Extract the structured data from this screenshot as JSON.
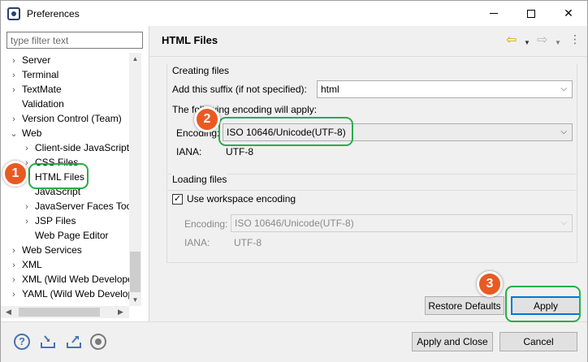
{
  "window": {
    "title": "Preferences"
  },
  "sidebar": {
    "filter_placeholder": "type filter text",
    "items": [
      {
        "label": "Server",
        "chevron": "›"
      },
      {
        "label": "Terminal",
        "chevron": "›"
      },
      {
        "label": "TextMate",
        "chevron": "›"
      },
      {
        "label": "Validation",
        "chevron": ""
      },
      {
        "label": "Version Control (Team)",
        "chevron": "›"
      },
      {
        "label": "Web",
        "chevron": "⌄"
      },
      {
        "label": "Client-side JavaScript",
        "chevron": "›"
      },
      {
        "label": "CSS Files",
        "chevron": "›"
      },
      {
        "label": "HTML Files",
        "chevron": ""
      },
      {
        "label": "JavaScript",
        "chevron": ""
      },
      {
        "label": "JavaServer Faces Tools",
        "chevron": "›"
      },
      {
        "label": "JSP Files",
        "chevron": "›"
      },
      {
        "label": "Web Page Editor",
        "chevron": ""
      },
      {
        "label": "Web Services",
        "chevron": "›"
      },
      {
        "label": "XML",
        "chevron": "›"
      },
      {
        "label": "XML (Wild Web Developer)",
        "chevron": "›"
      },
      {
        "label": "YAML (Wild Web Developer)",
        "chevron": "›"
      }
    ]
  },
  "page": {
    "title": "HTML Files",
    "creating": {
      "group_title": "Creating files",
      "suffix_label": "Add this suffix (if not specified):",
      "suffix_value": "html",
      "encoding_intro": "The following encoding will apply:",
      "encoding_label": "Encoding:",
      "encoding_value": "ISO 10646/Unicode(UTF-8)",
      "iana_label": "IANA:",
      "iana_value": "UTF-8"
    },
    "loading": {
      "group_title": "Loading files",
      "use_workspace_label": "Use workspace encoding",
      "use_workspace_checked": true,
      "encoding_label": "Encoding:",
      "encoding_value": "ISO 10646/Unicode(UTF-8)",
      "iana_label": "IANA:",
      "iana_value": "UTF-8"
    },
    "buttons": {
      "restore_defaults": "Restore Defaults",
      "apply": "Apply"
    }
  },
  "footer": {
    "apply_and_close": "Apply and Close",
    "cancel": "Cancel"
  },
  "annotations": {
    "step1": "1",
    "step2": "2",
    "step3": "3"
  },
  "colors": {
    "badge": "#e85a22",
    "highlight": "#27ae49",
    "accent": "#0078d7"
  }
}
